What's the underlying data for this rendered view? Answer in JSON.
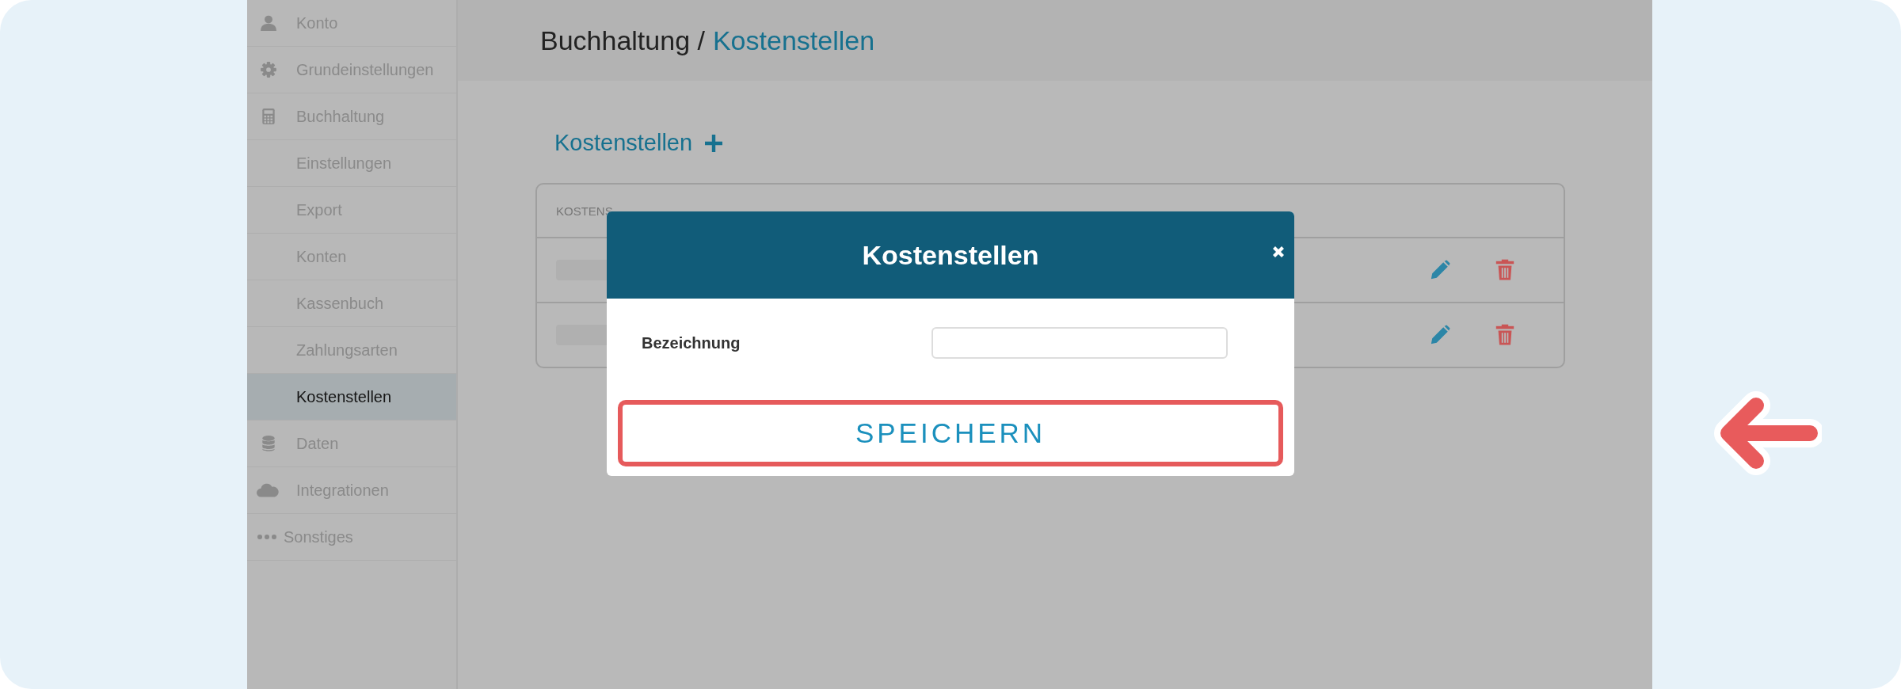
{
  "sidebar": {
    "items": [
      {
        "label": "Konto",
        "kind": "section",
        "selected": false
      },
      {
        "label": "Grundeinstellungen",
        "kind": "section",
        "selected": false
      },
      {
        "label": "Buchhaltung",
        "kind": "section",
        "selected": false
      },
      {
        "label": "Einstellungen",
        "kind": "subitem",
        "selected": false
      },
      {
        "label": "Export",
        "kind": "subitem",
        "selected": false
      },
      {
        "label": "Konten",
        "kind": "subitem",
        "selected": false
      },
      {
        "label": "Kassenbuch",
        "kind": "subitem",
        "selected": false
      },
      {
        "label": "Zahlungsarten",
        "kind": "subitem",
        "selected": false
      },
      {
        "label": "Kostenstellen",
        "kind": "subitem",
        "selected": true
      },
      {
        "label": "Daten",
        "kind": "section",
        "selected": false
      },
      {
        "label": "Integrationen",
        "kind": "section",
        "selected": false
      },
      {
        "label": "Sonstiges",
        "kind": "section",
        "selected": false
      }
    ]
  },
  "breadcrumb": {
    "parent": "Buchhaltung /",
    "current": "Kostenstellen"
  },
  "section": {
    "title": "Kostenstellen"
  },
  "table": {
    "columns": [
      "KOSTENS"
    ]
  },
  "modal": {
    "title": "Kostenstellen",
    "fields": [
      {
        "label": "Bezeichnung"
      }
    ],
    "save_button": "SPEICHERN"
  }
}
